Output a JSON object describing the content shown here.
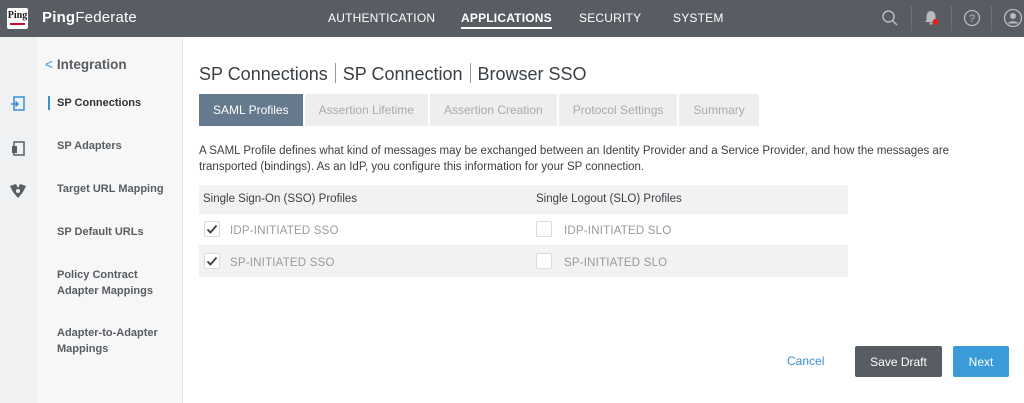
{
  "app": {
    "logo_text": "Ping",
    "brand_bold": "Ping",
    "brand_rest": "Federate"
  },
  "nav": {
    "items": [
      {
        "label": "AUTHENTICATION"
      },
      {
        "label": "APPLICATIONS",
        "active": true
      },
      {
        "label": "SECURITY"
      },
      {
        "label": "SYSTEM"
      }
    ],
    "icons": [
      "search-icon",
      "notification-bell-icon",
      "help-icon",
      "user-icon"
    ]
  },
  "rail": {
    "icons": [
      "sp-connections-icon",
      "sp-adapters-icon",
      "target-mapping-icon"
    ]
  },
  "sidebar": {
    "back_label": "Integration",
    "items": [
      {
        "label": "SP Connections",
        "active": true
      },
      {
        "label": "SP Adapters"
      },
      {
        "label": "Target URL Mapping"
      },
      {
        "label": "SP Default URLs"
      },
      {
        "label": "Policy Contract Adapter Mappings"
      },
      {
        "label": "Adapter-to-Adapter Mappings"
      }
    ]
  },
  "breadcrumb": [
    "SP Connections",
    "SP Connection",
    "Browser SSO"
  ],
  "tabs": [
    {
      "label": "SAML Profiles",
      "active": true
    },
    {
      "label": "Assertion Lifetime"
    },
    {
      "label": "Assertion Creation"
    },
    {
      "label": "Protocol Settings"
    },
    {
      "label": "Summary"
    }
  ],
  "description": "A SAML Profile defines what kind of messages may be exchanged between an Identity Provider and a Service Provider, and how the messages are transported (bindings). As an IdP, you configure this information for your SP connection.",
  "profiles": {
    "sso_header": "Single Sign-On (SSO) Profiles",
    "slo_header": "Single Logout (SLO) Profiles",
    "rows": [
      {
        "sso_label": "IDP-INITIATED SSO",
        "sso_checked": true,
        "slo_label": "IDP-INITIATED SLO",
        "slo_checked": false
      },
      {
        "sso_label": "SP-INITIATED SSO",
        "sso_checked": true,
        "slo_label": "SP-INITIATED SLO",
        "slo_checked": false
      }
    ]
  },
  "actions": {
    "cancel": "Cancel",
    "save_draft": "Save Draft",
    "next": "Next"
  },
  "colors": {
    "topbar": "#575d63",
    "accent": "#3a9bd9",
    "active_tab": "#657a8c",
    "alert": "#e02020"
  }
}
